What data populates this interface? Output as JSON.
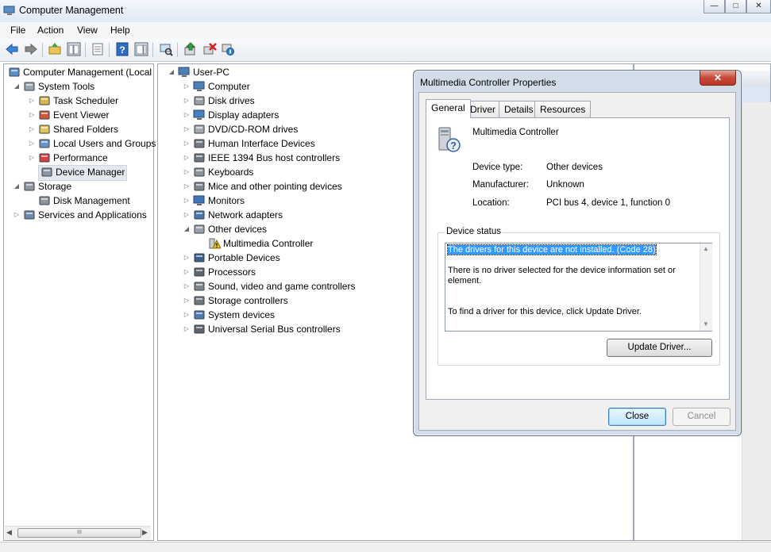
{
  "window": {
    "title": "Computer Management",
    "minimize_glyph": "—",
    "maximize_glyph": "□",
    "close_glyph": "✕"
  },
  "menu": [
    "File",
    "Action",
    "View",
    "Help"
  ],
  "toolbar_icons": [
    "back-arrow-icon",
    "forward-arrow-icon",
    "up-folder-icon",
    "show-hide-tree-icon",
    "properties-icon",
    "help-icon",
    "action-pane-icon",
    "scan-hardware-icon",
    "update-driver-icon",
    "uninstall-icon",
    "disable-device-icon"
  ],
  "left_tree": [
    {
      "label": "Computer Management (Local",
      "level": 0,
      "toggle": "",
      "icon": "computer-management-icon"
    },
    {
      "label": "System Tools",
      "level": 1,
      "toggle": "◢",
      "icon": "system-tools-icon"
    },
    {
      "label": "Task Scheduler",
      "level": 2,
      "toggle": "▷",
      "icon": "task-scheduler-icon"
    },
    {
      "label": "Event Viewer",
      "level": 2,
      "toggle": "▷",
      "icon": "event-viewer-icon"
    },
    {
      "label": "Shared Folders",
      "level": 2,
      "toggle": "▷",
      "icon": "shared-folders-icon"
    },
    {
      "label": "Local Users and Groups",
      "level": 2,
      "toggle": "▷",
      "icon": "local-users-icon"
    },
    {
      "label": "Performance",
      "level": 2,
      "toggle": "▷",
      "icon": "performance-icon"
    },
    {
      "label": "Device Manager",
      "level": 2,
      "toggle": "",
      "icon": "device-manager-icon",
      "selected": true
    },
    {
      "label": "Storage",
      "level": 1,
      "toggle": "◢",
      "icon": "storage-icon"
    },
    {
      "label": "Disk Management",
      "level": 2,
      "toggle": "",
      "icon": "disk-management-icon"
    },
    {
      "label": "Services and Applications",
      "level": 1,
      "toggle": "▷",
      "icon": "services-icon"
    }
  ],
  "device_tree": [
    {
      "label": "User-PC",
      "level": 0,
      "toggle": "◢",
      "icon": "computer-icon"
    },
    {
      "label": "Computer",
      "level": 1,
      "toggle": "▷",
      "icon": "computer-icon"
    },
    {
      "label": "Disk drives",
      "level": 1,
      "toggle": "▷",
      "icon": "disk-drive-icon"
    },
    {
      "label": "Display adapters",
      "level": 1,
      "toggle": "▷",
      "icon": "display-adapter-icon"
    },
    {
      "label": "DVD/CD-ROM drives",
      "level": 1,
      "toggle": "▷",
      "icon": "dvd-drive-icon"
    },
    {
      "label": "Human Interface Devices",
      "level": 1,
      "toggle": "▷",
      "icon": "hid-icon"
    },
    {
      "label": "IEEE 1394 Bus host controllers",
      "level": 1,
      "toggle": "▷",
      "icon": "ieee1394-icon"
    },
    {
      "label": "Keyboards",
      "level": 1,
      "toggle": "▷",
      "icon": "keyboard-icon"
    },
    {
      "label": "Mice and other pointing devices",
      "level": 1,
      "toggle": "▷",
      "icon": "mouse-icon"
    },
    {
      "label": "Monitors",
      "level": 1,
      "toggle": "▷",
      "icon": "monitor-icon"
    },
    {
      "label": "Network adapters",
      "level": 1,
      "toggle": "▷",
      "icon": "network-adapter-icon"
    },
    {
      "label": "Other devices",
      "level": 1,
      "toggle": "◢",
      "icon": "other-devices-icon"
    },
    {
      "label": "Multimedia Controller",
      "level": 2,
      "toggle": "",
      "icon": "warning-device-icon"
    },
    {
      "label": "Portable Devices",
      "level": 1,
      "toggle": "▷",
      "icon": "portable-device-icon"
    },
    {
      "label": "Processors",
      "level": 1,
      "toggle": "▷",
      "icon": "processor-icon"
    },
    {
      "label": "Sound, video and game controllers",
      "level": 1,
      "toggle": "▷",
      "icon": "sound-icon"
    },
    {
      "label": "Storage controllers",
      "level": 1,
      "toggle": "▷",
      "icon": "storage-controller-icon"
    },
    {
      "label": "System devices",
      "level": 1,
      "toggle": "▷",
      "icon": "system-device-icon"
    },
    {
      "label": "Universal Serial Bus controllers",
      "level": 1,
      "toggle": "▷",
      "icon": "usb-icon"
    }
  ],
  "hscroll_grip": "III",
  "dialog": {
    "title": "Multimedia Controller Properties",
    "close_glyph": "✕",
    "tabs": [
      "General",
      "Driver",
      "Details",
      "Resources"
    ],
    "device_name": "Multimedia Controller",
    "props": [
      {
        "label": "Device type:",
        "value": "Other devices"
      },
      {
        "label": "Manufacturer:",
        "value": "Unknown"
      },
      {
        "label": "Location:",
        "value": "PCI bus 4, device 1, function 0"
      }
    ],
    "status_legend": "Device status",
    "status_line1": "The drivers for this device are not installed. (Code 28)",
    "status_line2": "There is no driver selected for the device information set or element.",
    "status_line3": "To find a driver for this device, click Update Driver.",
    "update_button": "Update Driver...",
    "close_button": "Close",
    "cancel_button": "Cancel"
  }
}
